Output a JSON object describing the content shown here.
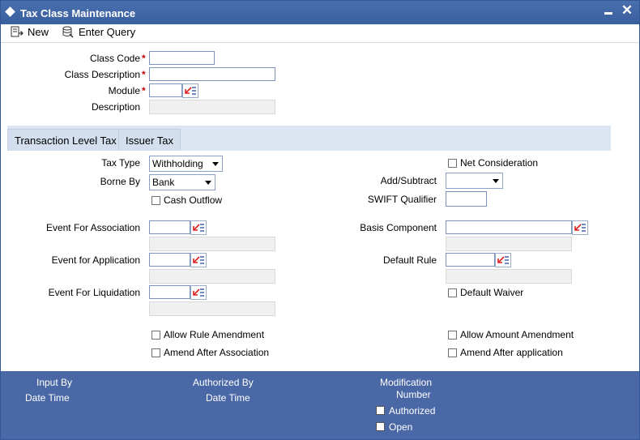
{
  "window": {
    "title": "Tax Class Maintenance"
  },
  "toolbar": {
    "new_label": "New",
    "enter_query_label": "Enter Query"
  },
  "header": {
    "class_code_label": "Class Code",
    "class_code_value": "",
    "class_description_label": "Class Description",
    "class_description_value": "",
    "module_label": "Module",
    "module_value": "",
    "description_label": "Description",
    "description_value": "",
    "required_marker": "*"
  },
  "tabs": [
    {
      "label": "Transaction Level Tax",
      "active": true
    },
    {
      "label": "Issuer Tax",
      "active": false
    }
  ],
  "form": {
    "tax_type_label": "Tax Type",
    "tax_type_value": "Withholding",
    "borne_by_label": "Borne By",
    "borne_by_value": "Bank",
    "cash_outflow_label": "Cash Outflow",
    "net_consideration_label": "Net Consideration",
    "add_subtract_label": "Add/Subtract",
    "add_subtract_value": "",
    "swift_qualifier_label": "SWIFT Qualifier",
    "swift_qualifier_value": "",
    "event_for_association_label": "Event For Association",
    "event_for_application_label": "Event for Application",
    "event_for_liquidation_label": "Event For Liquidation",
    "basis_component_label": "Basis Component",
    "default_rule_label": "Default Rule",
    "default_waiver_label": "Default Waiver",
    "allow_rule_amendment_label": "Allow Rule Amendment",
    "amend_after_association_label": "Amend After Association",
    "allow_amount_amendment_label": "Allow Amount Amendment",
    "amend_after_application_label": "Amend After application"
  },
  "footer": {
    "input_by_label": "Input By",
    "date_time_label_1": "Date Time",
    "authorized_by_label": "Authorized By",
    "date_time_label_2": "Date Time",
    "modification_label": "Modification",
    "number_label": "Number",
    "authorized_label": "Authorized",
    "open_label": "Open"
  },
  "colors": {
    "titlebar": "#3a5f9f",
    "footer": "#4a68a5",
    "tabstrip": "#dce6f2",
    "required": "#cc0000"
  },
  "icons": [
    "window-icon",
    "minimize-icon",
    "close-icon",
    "new-icon",
    "enter-query-icon",
    "lov-icon"
  ]
}
